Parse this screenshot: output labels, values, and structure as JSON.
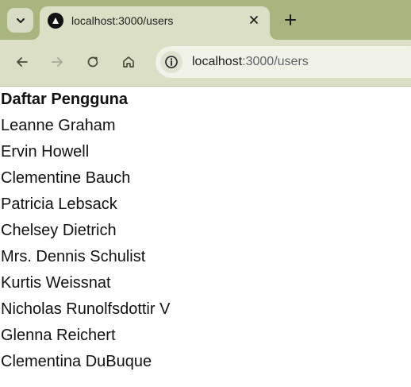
{
  "browser": {
    "tab": {
      "title": "localhost:3000/users",
      "favicon": "nextjs-triangle-icon"
    },
    "toolbar": {
      "url_host": "localhost",
      "url_path": ":3000/users"
    },
    "colors": {
      "frame": "#a9b57e",
      "toolbar": "#dadfc5",
      "omnibox": "#f1f2e8"
    }
  },
  "page": {
    "heading": "Daftar Pengguna",
    "users": [
      "Leanne Graham",
      "Ervin Howell",
      "Clementine Bauch",
      "Patricia Lebsack",
      "Chelsey Dietrich",
      "Mrs. Dennis Schulist",
      "Kurtis Weissnat",
      "Nicholas Runolfsdottir V",
      "Glenna Reichert",
      "Clementina DuBuque"
    ]
  }
}
